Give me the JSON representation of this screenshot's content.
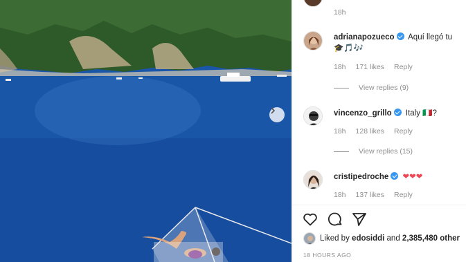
{
  "post": {
    "next_icon": "chevron-right-icon"
  },
  "comments": [
    {
      "username": "",
      "time": "18h"
    },
    {
      "username": "adrianapozueco",
      "text": "Aquí llegó tu",
      "text_line2": "🎓🎵🎶",
      "time": "18h",
      "likes": "171 likes",
      "reply": "Reply",
      "view_replies": "View replies (9)"
    },
    {
      "username": "vincenzo_grillo",
      "text": "Italy 🇮🇹?",
      "time": "18h",
      "likes": "128 likes",
      "reply": "Reply",
      "view_replies": "View replies (15)"
    },
    {
      "username": "cristipedroche",
      "text": "❤❤❤",
      "time": "18h",
      "likes": "137 likes",
      "reply": "Reply"
    }
  ],
  "actions": {
    "like_icon": "heart-icon",
    "comment_icon": "comment-icon",
    "share_icon": "share-icon"
  },
  "liked_by": {
    "prefix": "Liked by",
    "user": "edosiddi",
    "connector": "and",
    "count": "2,385,480 other"
  },
  "timestamp": "18 HOURS AGO",
  "colors": {
    "verified": "#3897f0",
    "meta": "#8e8e8e",
    "sea": "#1a55a6"
  }
}
